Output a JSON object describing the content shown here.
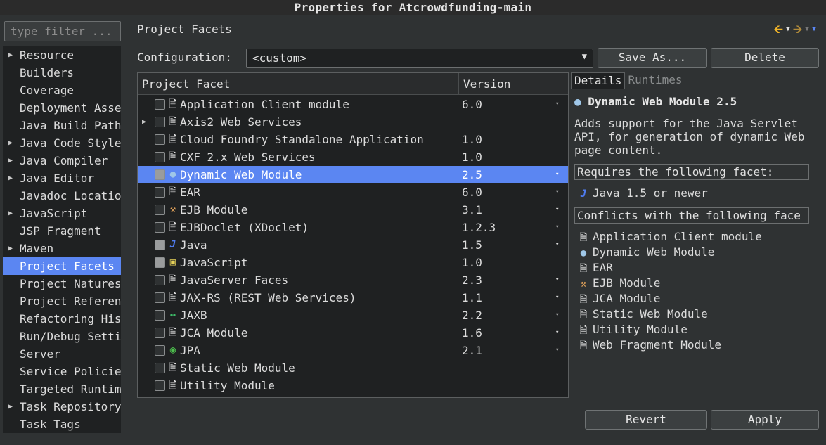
{
  "window": {
    "title": "Properties for Atcrowdfunding-main"
  },
  "filter": {
    "placeholder": "type filter ..."
  },
  "nav": {
    "items": [
      {
        "label": "Resource",
        "expandable": true
      },
      {
        "label": "Builders",
        "expandable": false
      },
      {
        "label": "Coverage",
        "expandable": false
      },
      {
        "label": "Deployment Asse",
        "expandable": false
      },
      {
        "label": "Java Build Path",
        "expandable": false
      },
      {
        "label": "Java Code Style",
        "expandable": true
      },
      {
        "label": "Java Compiler",
        "expandable": true
      },
      {
        "label": "Java Editor",
        "expandable": true
      },
      {
        "label": "Javadoc Locatio",
        "expandable": false
      },
      {
        "label": "JavaScript",
        "expandable": true
      },
      {
        "label": "JSP Fragment",
        "expandable": false
      },
      {
        "label": "Maven",
        "expandable": true
      },
      {
        "label": "Project Facets",
        "expandable": false,
        "selected": true
      },
      {
        "label": "Project Natures",
        "expandable": false
      },
      {
        "label": "Project Referen",
        "expandable": false
      },
      {
        "label": "Refactoring His",
        "expandable": false
      },
      {
        "label": "Run/Debug Setti",
        "expandable": false
      },
      {
        "label": "Server",
        "expandable": false
      },
      {
        "label": "Service Policie",
        "expandable": false
      },
      {
        "label": "Targeted Runtim",
        "expandable": false
      },
      {
        "label": "Task Repository",
        "expandable": true
      },
      {
        "label": "Task Tags",
        "expandable": false
      }
    ]
  },
  "page": {
    "title": "Project Facets",
    "configuration_label": "Configuration:",
    "configuration_value": "<custom>",
    "save_as_label": "Save As...",
    "delete_label": "Delete"
  },
  "table": {
    "col_facet": "Project Facet",
    "col_version": "Version",
    "rows": [
      {
        "name": "Application Client module",
        "version": "6.0",
        "icon": "file-icon",
        "checked": false,
        "dropdown": true
      },
      {
        "name": "Axis2 Web Services",
        "version": "",
        "icon": "file-icon",
        "checked": false,
        "expandable": true
      },
      {
        "name": "Cloud Foundry Standalone Application",
        "version": "1.0",
        "icon": "file-icon",
        "checked": false
      },
      {
        "name": "CXF 2.x Web Services",
        "version": "1.0",
        "icon": "file-icon",
        "checked": false
      },
      {
        "name": "Dynamic Web Module",
        "version": "2.5",
        "icon": "web-module-icon",
        "checked": true,
        "selected": true,
        "dropdown": true
      },
      {
        "name": "EAR",
        "version": "6.0",
        "icon": "file-icon",
        "checked": false,
        "dropdown": true
      },
      {
        "name": "EJB Module",
        "version": "3.1",
        "icon": "ejb-icon",
        "checked": false,
        "dropdown": true
      },
      {
        "name": "EJBDoclet (XDoclet)",
        "version": "1.2.3",
        "icon": "file-icon",
        "checked": false,
        "dropdown": true
      },
      {
        "name": "Java",
        "version": "1.5",
        "icon": "java-icon",
        "checked": true,
        "dropdown": true
      },
      {
        "name": "JavaScript",
        "version": "1.0",
        "icon": "javascript-icon",
        "checked": true
      },
      {
        "name": "JavaServer Faces",
        "version": "2.3",
        "icon": "file-icon",
        "checked": false,
        "dropdown": true
      },
      {
        "name": "JAX-RS (REST Web Services)",
        "version": "1.1",
        "icon": "file-icon",
        "checked": false,
        "dropdown": true
      },
      {
        "name": "JAXB",
        "version": "2.2",
        "icon": "jaxb-icon",
        "checked": false,
        "dropdown": true
      },
      {
        "name": "JCA Module",
        "version": "1.6",
        "icon": "file-icon",
        "checked": false,
        "dropdown": true
      },
      {
        "name": "JPA",
        "version": "2.1",
        "icon": "jpa-icon",
        "checked": false,
        "dropdown": true
      },
      {
        "name": "Static Web Module",
        "version": "",
        "icon": "file-icon",
        "checked": false
      },
      {
        "name": "Utility Module",
        "version": "",
        "icon": "file-icon",
        "checked": false
      }
    ]
  },
  "details": {
    "tab_details": "Details",
    "tab_runtimes": "Runtimes",
    "title": "Dynamic Web Module 2.5",
    "description": "Adds support for the Java Servlet API, for generation of dynamic Web page content.",
    "requires_label": "Requires the following facet:",
    "requires": [
      {
        "label": "Java 1.5 or newer",
        "icon": "java-icon"
      }
    ],
    "conflicts_label": "Conflicts with the following face",
    "conflicts": [
      {
        "label": "Application Client module",
        "icon": "file-icon"
      },
      {
        "label": "Dynamic Web Module",
        "icon": "web-module-icon"
      },
      {
        "label": "EAR",
        "icon": "file-icon"
      },
      {
        "label": "EJB Module",
        "icon": "ejb-icon"
      },
      {
        "label": "JCA Module",
        "icon": "file-icon"
      },
      {
        "label": "Static Web Module",
        "icon": "file-icon"
      },
      {
        "label": "Utility Module",
        "icon": "file-icon"
      },
      {
        "label": "Web Fragment Module",
        "icon": "file-icon"
      }
    ]
  },
  "footer": {
    "revert_label": "Revert",
    "apply_label": "Apply"
  },
  "colors": {
    "selection": "#5b86f2",
    "background": "#2f3233",
    "panel": "#1f2122",
    "back_arrow": "#f0b429"
  }
}
